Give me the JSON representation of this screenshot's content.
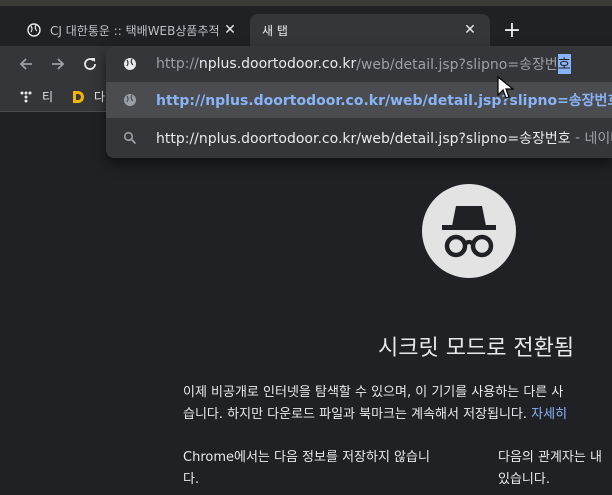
{
  "tabs": [
    {
      "title": "CJ 대한통운 :: 택배WEB상품추적",
      "active": false
    },
    {
      "title": "새 탭",
      "active": true
    }
  ],
  "bookmarks": [
    {
      "label": "티"
    },
    {
      "label": "다"
    }
  ],
  "omnibox": {
    "input": {
      "scheme": "http://",
      "host": "nplus.doortodoor.co.kr",
      "path": "/web/detail.jsp?slipno=송장번",
      "selected": "호"
    },
    "suggestions": [
      {
        "text": "http://nplus.doortodoor.co.kr/web/detail.jsp?slipno=송장번호",
        "highlighted": true
      },
      {
        "text": "http://nplus.doortodoor.co.kr/web/detail.jsp?slipno=송장번호",
        "separator": " - ",
        "suffix": "네이버 검"
      }
    ]
  },
  "page": {
    "heading": "시크릿 모드로 전환됨",
    "intro_line1": "이제 비공개로 인터넷을 탐색할 수 있으며, 이 기기를 사용하는 다른 사",
    "intro_line2": "습니다. 하지만 다운로드 파일과 북마크는 계속해서 저장됩니다.",
    "intro_link": "자세히",
    "col1_line1": "Chrome에서는 다음 정보를 저장하지 않습니",
    "col1_line2": "다.",
    "col2_line1": "다음의 관계자는 내",
    "col2_line2": "있습니다."
  },
  "colors": {
    "accent": "#8ab4f8",
    "background": "#202124",
    "toolbar": "#35363a"
  }
}
